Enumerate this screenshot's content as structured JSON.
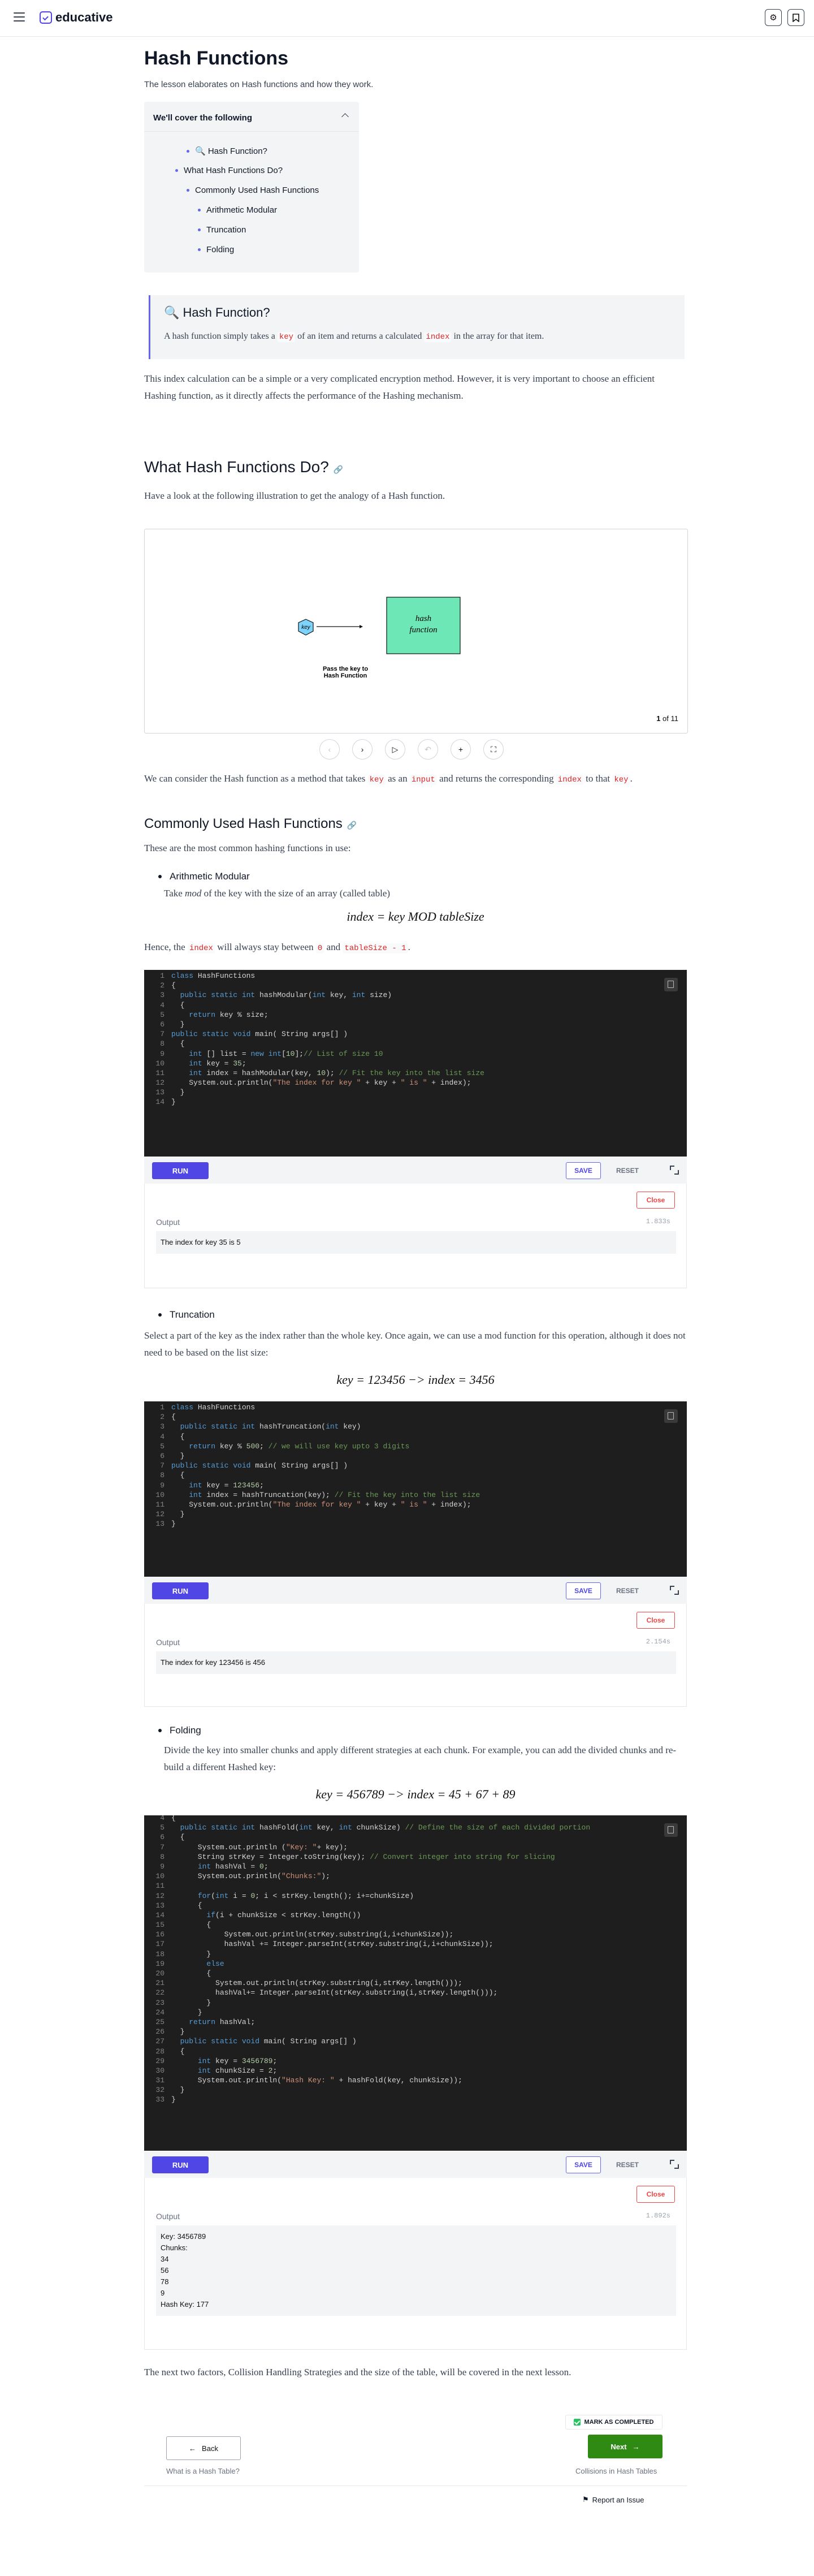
{
  "brand": {
    "name": "educative"
  },
  "header": {
    "settings_icon": "gear-icon",
    "bookmark_icon": "bookmark-icon"
  },
  "lesson": {
    "title": "Hash Functions",
    "subtitle": "The lesson elaborates on Hash functions and how they work."
  },
  "toc": {
    "heading": "We'll cover the following",
    "items": [
      "🔍 Hash Function?",
      "What Hash Functions Do?",
      "Commonly Used Hash Functions",
      "Arithmetic Modular",
      "Truncation",
      "Folding"
    ]
  },
  "callout": {
    "title": "🔍 Hash Function?",
    "text_a": "A hash function simply takes a ",
    "code_a": "key",
    "text_b": " of an item and returns a calculated ",
    "code_b": "index",
    "text_c": " in the array for that item."
  },
  "para1": "This index calculation can be a simple or a very complicated encryption method. However, it is very important to choose an efficient Hashing function, as it directly affects the performance of the Hashing mechanism.",
  "section1": {
    "heading": "What Hash Functions Do?",
    "intro": "Have a look at the following illustration to get the analogy of a Hash function."
  },
  "slides": {
    "key_label": "key",
    "box_label_1": "hash",
    "box_label_2": "function",
    "caption_1": "Pass the key to",
    "caption_2": "Hash Function",
    "current": 1,
    "total": 11,
    "counter_text": "of 11"
  },
  "para2": {
    "t1": "We can consider the Hash function as a method that takes ",
    "c1": "key",
    "t2": " as an ",
    "c2": "input",
    "t3": " and returns the corresponding ",
    "c3": "index",
    "t4": " to that ",
    "c4": "key",
    "t5": "."
  },
  "section2": {
    "heading": "Commonly Used Hash Functions",
    "intro": "These are the most common hashing functions in use:"
  },
  "arith": {
    "label": "Arithmetic Modular",
    "desc_a": "Take ",
    "desc_em": "mod",
    "desc_b": " of the key with the size of an array (called table)",
    "formula": "index = key MOD tableSize",
    "after_a": "Hence, the ",
    "after_c1": "index",
    "after_b": " will always stay between ",
    "after_c2": "0",
    "after_c": " and ",
    "after_c3": "tableSize - 1",
    "after_d": "."
  },
  "trunc": {
    "label": "Truncation",
    "desc": "Select a part of the key as the index rather than the whole key. Once again, we can use a mod function for this operation, although it does not need to be based on the list size:",
    "formula": "key = 123456  −>  index = 3456"
  },
  "fold": {
    "label": "Folding",
    "desc": "Divide the key into smaller chunks and apply different strategies at each chunk. For example, you can add the divided chunks and re-build a different Hashed key:",
    "formula": "key = 456789  −>  index = 45 + 67 + 89"
  },
  "widgets": {
    "run_label": "RUN",
    "save_label": "SAVE",
    "reset_label": "RESET",
    "close_label": "Close",
    "output_label": "Output",
    "w1": {
      "time": "1.833s",
      "output": "The index for key 35 is 5"
    },
    "w2": {
      "time": "2.154s",
      "output": "The index for key 123456 is 456"
    },
    "w3": {
      "time": "1.892s",
      "output": "Key: 3456789\nChunks:\n34\n56\n78\n9\nHash Key: 177"
    }
  },
  "closing": "The next two factors, Collision Handling Strategies and the size of the table, will be covered in the next lesson.",
  "footer": {
    "mark_completed": "MARK AS COMPLETED",
    "back_label": "Back",
    "next_label": "Next",
    "prev_title": "What is a Hash Table?",
    "next_title": "Collisions in Hash Tables",
    "report": "Report an Issue"
  }
}
